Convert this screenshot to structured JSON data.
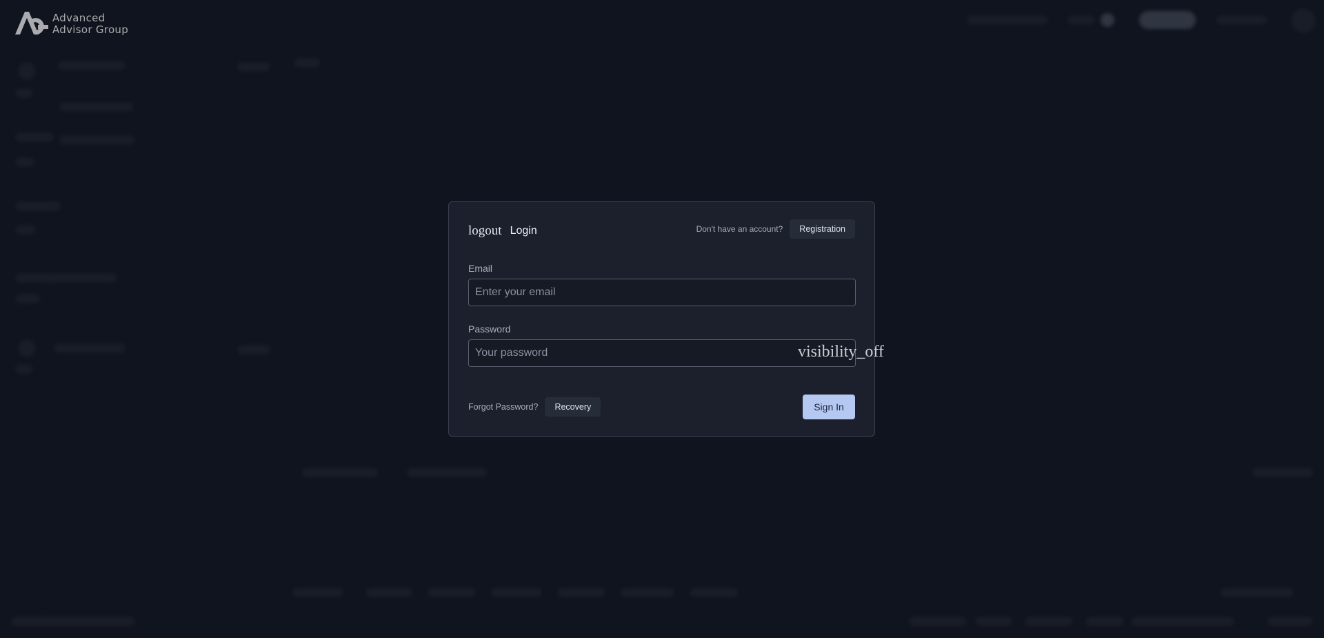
{
  "brand": {
    "line1": "Advanced",
    "line2": "Advisor Group"
  },
  "login_modal": {
    "title_icon": "logout",
    "title": "Login",
    "no_account_text": "Don't have an account?",
    "registration_button": "Registration",
    "email": {
      "label": "Email",
      "placeholder": "Enter your email",
      "value": ""
    },
    "password": {
      "label": "Password",
      "placeholder": "Your password",
      "value": "",
      "toggle_icon": "visibility_off"
    },
    "forgot_text": "Forgot Password?",
    "recovery_button": "Recovery",
    "sign_in_button": "Sign In"
  },
  "colors": {
    "page_background": "#131722",
    "modal_background": "#1b202c",
    "primary_button": "#b5c8f2",
    "secondary_button": "#262c38"
  }
}
